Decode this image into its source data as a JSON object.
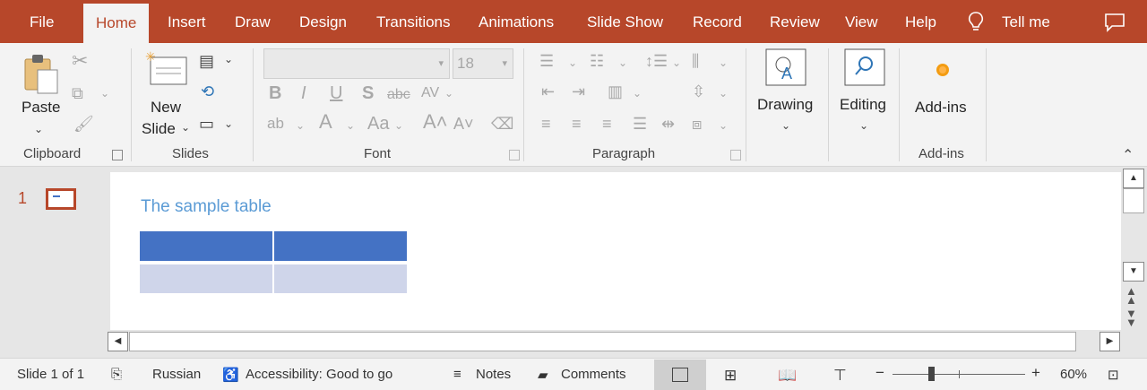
{
  "tabs": [
    "File",
    "Home",
    "Insert",
    "Draw",
    "Design",
    "Transitions",
    "Animations",
    "Slide Show",
    "Record",
    "Review",
    "View",
    "Help"
  ],
  "active_tab": "Home",
  "tell_me": "Tell me",
  "ribbon": {
    "clipboard": {
      "paste_label": "Paste",
      "group_label": "Clipboard"
    },
    "slides": {
      "new_label": "New",
      "slide_label": "Slide",
      "group_label": "Slides"
    },
    "font": {
      "font_size": "18",
      "group_label": "Font"
    },
    "paragraph": {
      "group_label": "Paragraph"
    },
    "drawing": {
      "label": "Drawing"
    },
    "editing": {
      "label": "Editing"
    },
    "addins": {
      "label": "Add-ins",
      "group_label": "Add-ins"
    }
  },
  "thumbnail": {
    "number": "1"
  },
  "slide": {
    "title": "The sample table",
    "table": {
      "header_color": "#4472c4",
      "row_color": "#cfd5ea",
      "columns": 2,
      "rows": 2
    }
  },
  "status": {
    "slide_count": "Slide 1 of 1",
    "language": "Russian",
    "accessibility": "Accessibility: Good to go",
    "notes": "Notes",
    "comments": "Comments",
    "zoom": "60%",
    "zoom_minus": "−",
    "zoom_plus": "+"
  },
  "colors": {
    "accent": "#b7472a",
    "title_text": "#5b9bd5"
  }
}
